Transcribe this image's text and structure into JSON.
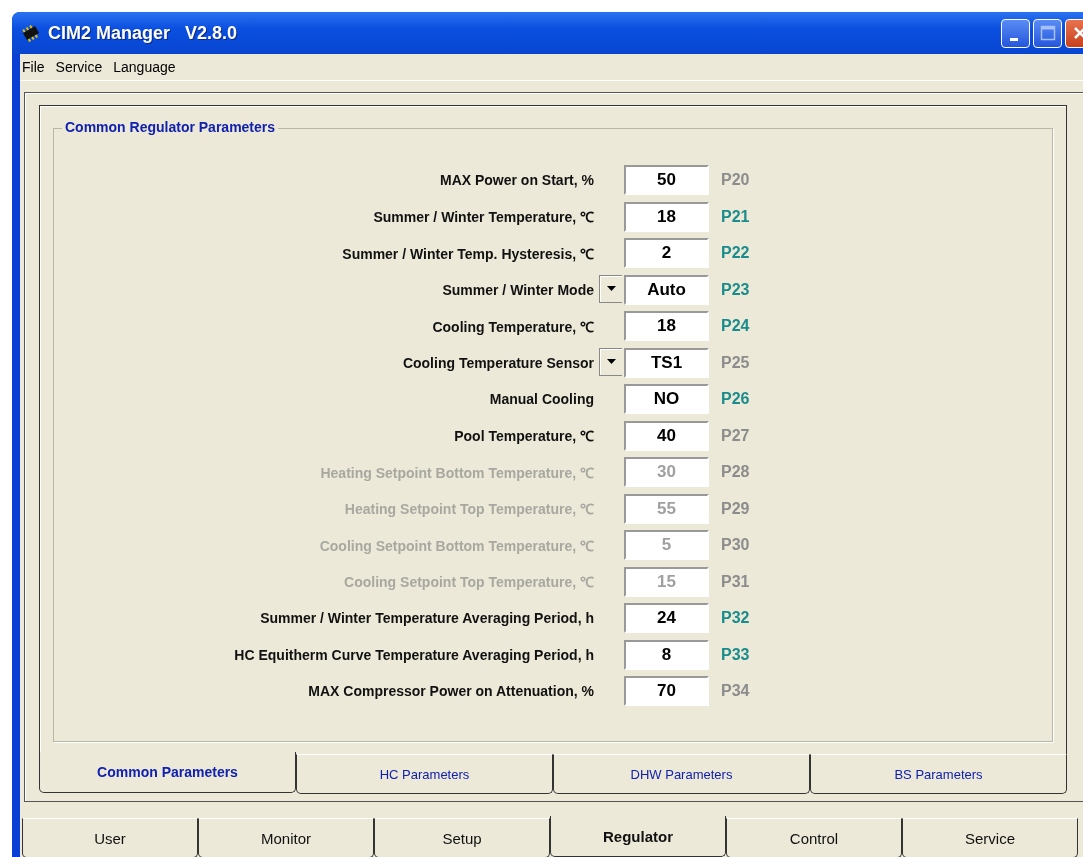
{
  "window": {
    "title": "CIM2 Manager   V2.8.0"
  },
  "menu": [
    "File",
    "Service",
    "Language"
  ],
  "group": {
    "title": "Common Regulator Parameters"
  },
  "params": [
    {
      "kind": "field",
      "label": "MAX Power on Start, %",
      "value": "50",
      "code": "P20",
      "color": "#8c8c8c",
      "disabled": false
    },
    {
      "kind": "field",
      "label": "Summer / Winter Temperature, ℃",
      "value": "18",
      "code": "P21",
      "color": "#1a8c8c",
      "disabled": false
    },
    {
      "kind": "field",
      "label": "Summer / Winter Temp. Hysteresis, ℃",
      "value": "2",
      "code": "P22",
      "color": "#1a8c8c",
      "disabled": false
    },
    {
      "kind": "dropdown",
      "label": "Summer / Winter Mode",
      "value": "Auto",
      "code": "P23",
      "color": "#1a8c8c",
      "disabled": false
    },
    {
      "kind": "field",
      "label": "Cooling Temperature, ℃",
      "value": "18",
      "code": "P24",
      "color": "#1a8c8c",
      "disabled": false
    },
    {
      "kind": "dropdown",
      "label": "Cooling Temperature Sensor",
      "value": "TS1",
      "code": "P25",
      "color": "#8c8c8c",
      "disabled": false
    },
    {
      "kind": "field",
      "label": "Manual Cooling",
      "value": "NO",
      "code": "P26",
      "color": "#1a8c8c",
      "disabled": false
    },
    {
      "kind": "field",
      "label": "Pool Temperature, ℃",
      "value": "40",
      "code": "P27",
      "color": "#8c8c8c",
      "disabled": false
    },
    {
      "kind": "field",
      "label": "Heating Setpoint Bottom Temperature, ℃",
      "value": "30",
      "code": "P28",
      "color": "#8c8c8c",
      "disabled": true
    },
    {
      "kind": "field",
      "label": "Heating Setpoint Top Temperature, ℃",
      "value": "55",
      "code": "P29",
      "color": "#8c8c8c",
      "disabled": true
    },
    {
      "kind": "field",
      "label": "Cooling Setpoint Bottom Temperature, ℃",
      "value": "5",
      "code": "P30",
      "color": "#8c8c8c",
      "disabled": true
    },
    {
      "kind": "field",
      "label": "Cooling Setpoint Top Temperature, ℃",
      "value": "15",
      "code": "P31",
      "color": "#8c8c8c",
      "disabled": true
    },
    {
      "kind": "field",
      "label": "Summer / Winter Temperature Averaging Period, h",
      "value": "24",
      "code": "P32",
      "color": "#1a8c8c",
      "disabled": false
    },
    {
      "kind": "field",
      "label": "HC Equitherm Curve Temperature Averaging Period, h",
      "value": "8",
      "code": "P33",
      "color": "#1a8c8c",
      "disabled": false
    },
    {
      "kind": "field",
      "label": "MAX Compressor Power on Attenuation, %",
      "value": "70",
      "code": "P34",
      "color": "#8c8c8c",
      "disabled": false
    }
  ],
  "sub_tabs": [
    {
      "label": "Common Parameters",
      "selected": true
    },
    {
      "label": "HC Parameters",
      "selected": false
    },
    {
      "label": "DHW Parameters",
      "selected": false
    },
    {
      "label": "BS Parameters",
      "selected": false
    }
  ],
  "main_tabs": [
    {
      "label": "User",
      "selected": false
    },
    {
      "label": "Monitor",
      "selected": false
    },
    {
      "label": "Setup",
      "selected": false
    },
    {
      "label": "Regulator",
      "selected": true
    },
    {
      "label": "Control",
      "selected": false
    },
    {
      "label": "Service",
      "selected": false
    }
  ]
}
